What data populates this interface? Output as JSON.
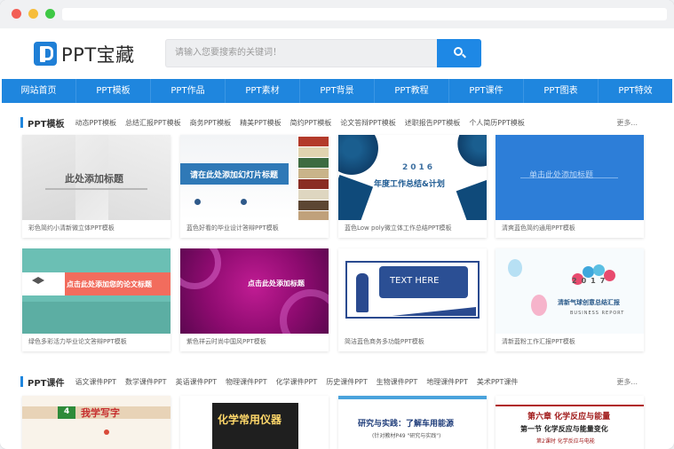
{
  "brand": {
    "name": "PPT宝藏"
  },
  "search": {
    "placeholder": "请输入您要搜索的关键词！"
  },
  "nav": [
    "网站首页",
    "PPT模板",
    "PPT作品",
    "PPT素材",
    "PPT背景",
    "PPT教程",
    "PPT课件",
    "PPT图表",
    "PPT特效"
  ],
  "section1": {
    "title": "PPT模板",
    "cats": [
      "动态PPT模板",
      "总结汇报PPT模板",
      "商务PPT模板",
      "精美PPT模板",
      "简约PPT模板",
      "论文答辩PPT模板",
      "述职报告PPT模板",
      "个人简历PPT模板"
    ],
    "more": "更多..."
  },
  "section2": {
    "title": "PPT课件",
    "cats": [
      "语文课件PPT",
      "数学课件PPT",
      "英语课件PPT",
      "物理课件PPT",
      "化学课件PPT",
      "历史课件PPT",
      "生物课件PPT",
      "地理课件PPT",
      "美术PPT课件"
    ],
    "more": "更多..."
  },
  "cards": [
    {
      "caption": "彩色简约小清新微立体PPT模板",
      "thumb_text": "此处添加标题"
    },
    {
      "caption": "蓝色好看的毕业设计答辩PPT模板",
      "thumb_text": "请在此处添加幻灯片标题"
    },
    {
      "caption": "蓝色Low poly微立体工作总结PPT模板",
      "thumb_text": "年度工作总结&计划",
      "thumb_num": "2016"
    },
    {
      "caption": "清爽蓝色简约通用PPT模板",
      "thumb_text": "单击此处添加标题"
    },
    {
      "caption": "绿色多彩活力毕业论文答辩PPT模板",
      "thumb_text": "点击此处添加您的论文标题"
    },
    {
      "caption": "紫色祥云时尚中国风PPT模板",
      "thumb_text": "点击此处添加标题"
    },
    {
      "caption": "简洁蓝色商务多功能PPT模板",
      "thumb_text": "TEXT HERE"
    },
    {
      "caption": "清新蓝粉工作汇报PPT模板",
      "thumb_text": "清新气球创意总结汇报",
      "thumb_num": "2017",
      "thumb_sub": "BUSINESS REPORT"
    }
  ],
  "course_cards": [
    {
      "thumb_text": "我学写字",
      "thumb_num": "4"
    },
    {
      "thumb_text": "化学常用仪器"
    },
    {
      "thumb_text": "研究与实践：了解车用能源",
      "thumb_sub": "(针对教材P49 \"研究与实践\")"
    },
    {
      "thumb_text": "第六章 化学反应与能量",
      "thumb_sub": "第一节 化学反应与能量变化",
      "thumb_sub2": "第2课时 化学反应与电能"
    }
  ],
  "colors": {
    "accent": "#1f86de"
  }
}
